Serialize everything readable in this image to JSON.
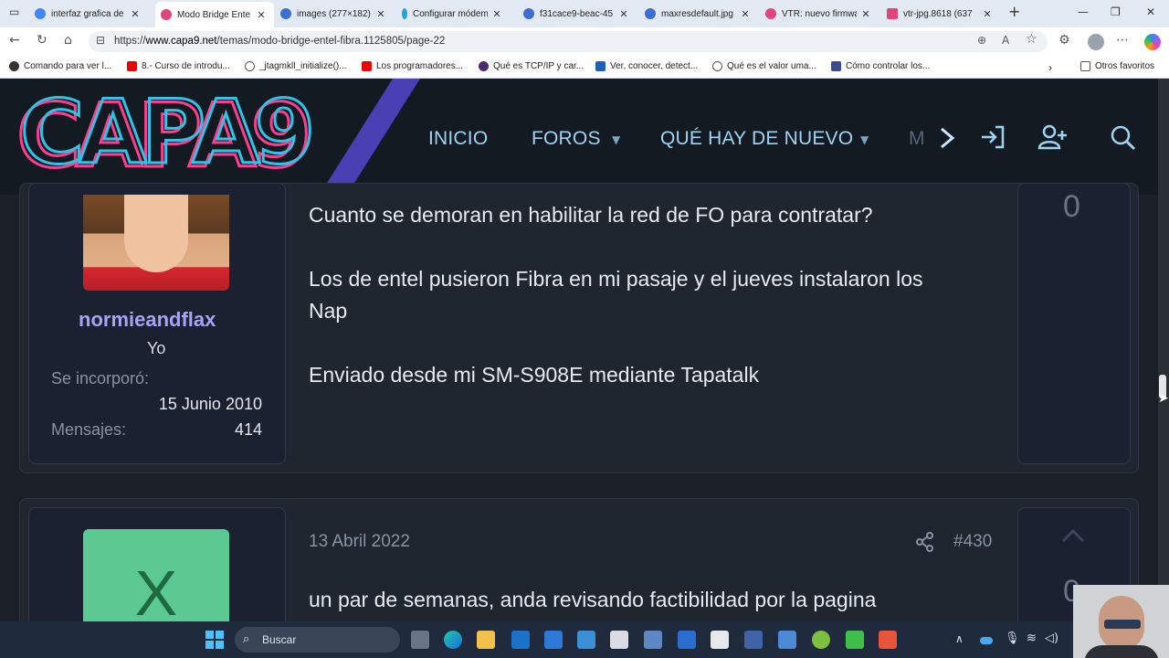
{
  "browser": {
    "tabs": [
      {
        "title": "interfaz grafica de",
        "color": "#4285f4"
      },
      {
        "title": "Modo Bridge Ente",
        "color": "#e0457b"
      },
      {
        "title": "images (277×182)",
        "color": "#3c6fd0"
      },
      {
        "title": "Configurar módem",
        "color": "#2aa0d8"
      },
      {
        "title": "f31cace9-beac-45",
        "color": "#3c6fd0"
      },
      {
        "title": "maxresdefault.jpg",
        "color": "#3c6fd0"
      },
      {
        "title": "VTR: nuevo firmwa",
        "color": "#e0457b"
      },
      {
        "title": "vtr-jpg.8618 (637",
        "color": "#e0457b"
      }
    ],
    "active_tab": 1,
    "url_prefix": "https://",
    "url_domain": "www.capa9.net",
    "url_path": "/temas/modo-bridge-entel-fibra.1125805/page-22",
    "bookmarks": [
      "Comando para ver l...",
      "8.- Curso de introdu...",
      "_jtagmkll_initialize()...",
      "Los programadores...",
      "Qué es TCP/IP y car...",
      "Ver, conocer, detect...",
      "Qué es el valor uma...",
      "Cómo controlar los..."
    ],
    "other_favorites": "Otros favoritos"
  },
  "site": {
    "logo_text": "CAPA9",
    "nav": [
      {
        "label": "INICIO"
      },
      {
        "label": "FOROS"
      },
      {
        "label": "QUÉ HAY DE NUEVO"
      },
      {
        "label": "M"
      }
    ]
  },
  "post1": {
    "user": {
      "name": "normieandflax",
      "title": "Yo",
      "joined_label": "Se incorporó:",
      "joined_value": "15 Junio 2010",
      "messages_label": "Mensajes:",
      "messages_value": "414"
    },
    "lines": [
      "Cuanto se demoran en habilitar la red de FO para contratar?",
      "Los de entel pusieron Fibra en mi pasaje y el jueves instalaron los",
      "Nap",
      "Enviado desde mi SM-S908E mediante Tapatalk"
    ],
    "votes": "0"
  },
  "post2": {
    "avatar_letter": "X",
    "date": "13 Abril 2022",
    "number": "#430",
    "line": "un par de semanas, anda revisando factibilidad por la pagina",
    "votes": "0"
  },
  "taskbar": {
    "search_placeholder": "Buscar"
  },
  "colors": {
    "accent": "#47c6c4",
    "username": "#a8a4f5",
    "nav": "#9fd3f2"
  }
}
